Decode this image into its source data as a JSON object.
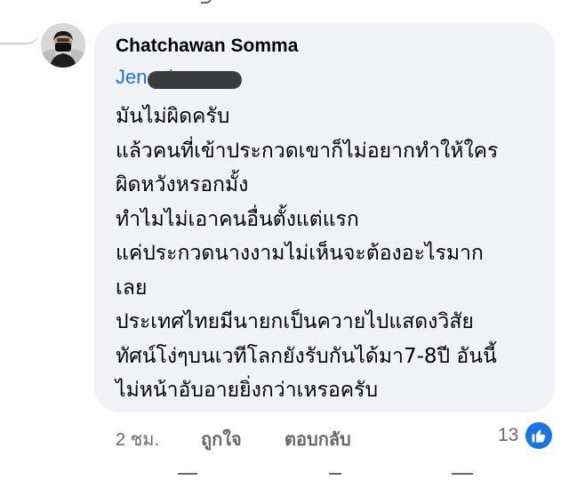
{
  "comment": {
    "author": "Chatchawan Somma",
    "mention": "Jen     etie",
    "lines": [
      "มันไม่ผิดครับ",
      "แล้วคนที่เข้าประกวดเขาก็ไม่อยากทำให้ใคร",
      "ผิดหวังหรอกมั้ง",
      "ทำไมไม่เอาคนอื่นตั้งแต่แรก",
      "แค่ประกวดนางงามไม่เห็นจะต้องอะไรมาก",
      "เลย",
      "ประเทศไทยมีนายกเป็นควายไปแสดงวิสัย",
      "ทัศน์โง่ๆบนเวทีโลกยังรับกันได้มา7-8ปี อันนี้",
      "ไม่หน้าอับอายยิ่งกว่าเหรอครับ"
    ]
  },
  "actions": {
    "time": "2 ชม.",
    "like": "ถูกใจ",
    "reply": "ตอบกลับ"
  },
  "reactions": {
    "count": "13",
    "icon": "thumbs-up-icon",
    "color": "#1b74e4"
  },
  "colors": {
    "bubble": "#f0f2f5",
    "mention": "#216fdb",
    "meta": "#65676b"
  }
}
